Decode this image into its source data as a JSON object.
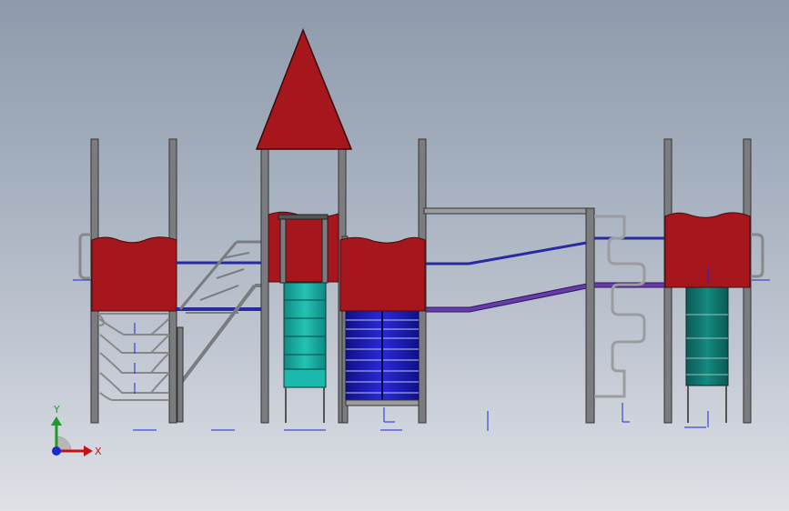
{
  "viewport": {
    "background_top": "#8e9aab",
    "background_bottom": "#dfe1e6"
  },
  "colors": {
    "roof_red": "#a5161d",
    "frame_gray": "#7a7c80",
    "rail_gray": "#9a9ca0",
    "beam_blue": "#2a2aa0",
    "slide_teal": "#1aa59a",
    "ladder_blue": "#1a1aa6",
    "purple_deck": "#6a3aa8",
    "axis_x_red": "#c0141a",
    "axis_y_green": "#1e9a2a",
    "axis_z_blue": "#1a2ad0"
  },
  "triad": {
    "x_label": "X",
    "y_label": "Y",
    "icon": "coordinate-triad-icon"
  },
  "model": {
    "type": "playground-structure-front-view",
    "components": [
      "left-tower",
      "cone-roof-tower",
      "center-tower",
      "monkey-bar-bridge",
      "climbing-wall",
      "right-tower"
    ]
  }
}
